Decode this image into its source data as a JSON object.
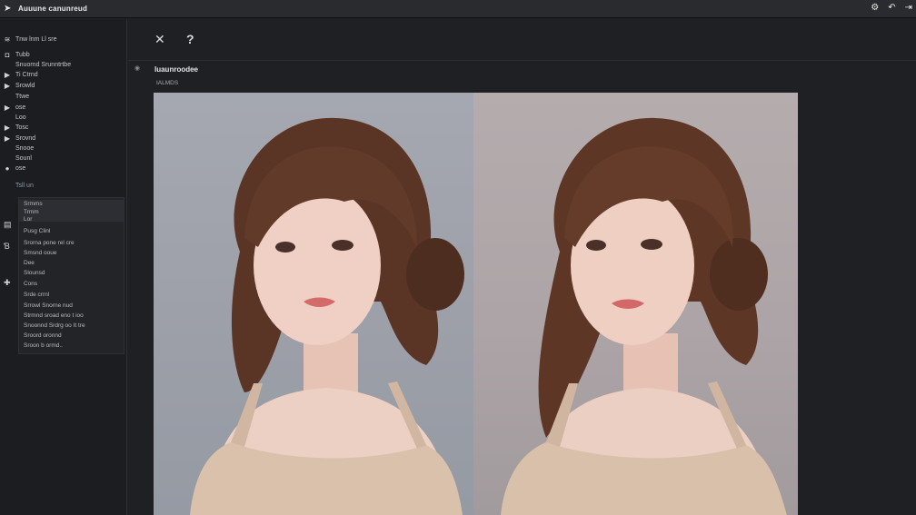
{
  "window": {
    "title": "Auuune canunreud",
    "app_icon": "back-arrow-icon",
    "controls": [
      "settings-icon",
      "undo-icon",
      "minimize-icon"
    ]
  },
  "sidebar": {
    "items": [
      {
        "icon": "rss-icon",
        "label": "Tnw lnm Ll sre"
      },
      {
        "icon": "shield-icon",
        "label": "Tubb"
      },
      {
        "icon": "",
        "label": "Snuornd  Srunntrtbe"
      },
      {
        "icon": "play-icon",
        "label": "Ti Ctrnd"
      },
      {
        "icon": "play-icon",
        "label": "Srowld"
      },
      {
        "icon": "",
        "label": "Ttwe"
      },
      {
        "icon": "play-icon",
        "label": "ose"
      },
      {
        "icon": "",
        "label": "Loo"
      },
      {
        "icon": "play-icon",
        "label": "Tosc"
      },
      {
        "icon": "play-icon",
        "label": "Srovnd"
      },
      {
        "icon": "",
        "label": "Snooe"
      },
      {
        "icon": "",
        "label": "Sounl"
      },
      {
        "icon": "circle-icon",
        "label": "ose"
      }
    ],
    "link": "Tsll un"
  },
  "panel": {
    "rows": [
      "Srmms",
      "Trmm",
      "Lor",
      "Pusg Clinl",
      "Srorna  pone rel  cre",
      "Smsnd   ooue",
      "Dee",
      "Slounsd",
      "Cons",
      "Srde crrnl",
      "Srrowl Snorne nud",
      "Strmnd sroad eno  t ioo",
      "Snoonnd  Srdrg oo It  tre",
      "Sroord  oronnd",
      "Sroon b ormd.."
    ]
  },
  "side_icons": [
    "document-icon",
    "text-icon",
    "add-icon"
  ],
  "toolbar": {
    "close": "✕",
    "help": "?"
  },
  "main": {
    "heading": "Iuaunroodee",
    "subheading": "IALMDS"
  },
  "colors": {
    "background": "#1f2023",
    "sidebar": "#1c1d20",
    "titlebar": "#2a2b2f",
    "panel": "#232428"
  }
}
